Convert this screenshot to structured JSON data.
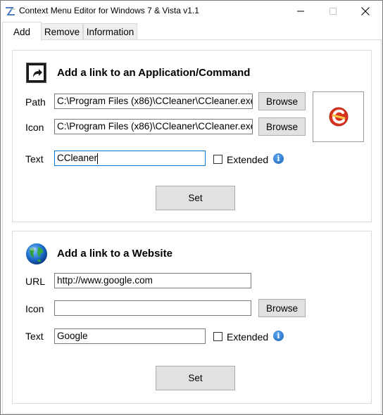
{
  "window": {
    "title": "Context Menu Editor for Windows 7 & Vista v1.1",
    "controls": {
      "minimize": "minimize-icon",
      "maximize": "maximize-icon",
      "close": "close-icon"
    }
  },
  "tabs": [
    {
      "label": "Add",
      "selected": true
    },
    {
      "label": "Remove",
      "selected": false
    },
    {
      "label": "Information",
      "selected": false
    }
  ],
  "app_section": {
    "title": "Add a link to an Application/Command",
    "icon": "shortcut-arrow-icon",
    "path_label": "Path",
    "path_value": "C:\\Program Files (x86)\\CCleaner\\CCleaner.exe",
    "path_browse": "Browse",
    "icon_label": "Icon",
    "icon_value": "C:\\Program Files (x86)\\CCleaner\\CCleaner.exe",
    "icon_browse": "Browse",
    "text_label": "Text",
    "text_value": "CCleaner",
    "extended_label": "Extended",
    "extended_checked": false,
    "info_icon": "info-icon",
    "preview_icon": "ccleaner-icon",
    "set_label": "Set"
  },
  "web_section": {
    "title": "Add a link to a Website",
    "icon": "globe-icon",
    "url_label": "URL",
    "url_value": "http://www.google.com",
    "icon_label": "Icon",
    "icon_value": "",
    "icon_browse": "Browse",
    "text_label": "Text",
    "text_value": "Google",
    "extended_label": "Extended",
    "extended_checked": false,
    "info_icon": "info-icon",
    "set_label": "Set"
  },
  "colors": {
    "accent": "#0078d7",
    "button_bg": "#e1e1e1",
    "info_blue": "#1c5fb5",
    "ccleaner_red": "#d9341f"
  }
}
